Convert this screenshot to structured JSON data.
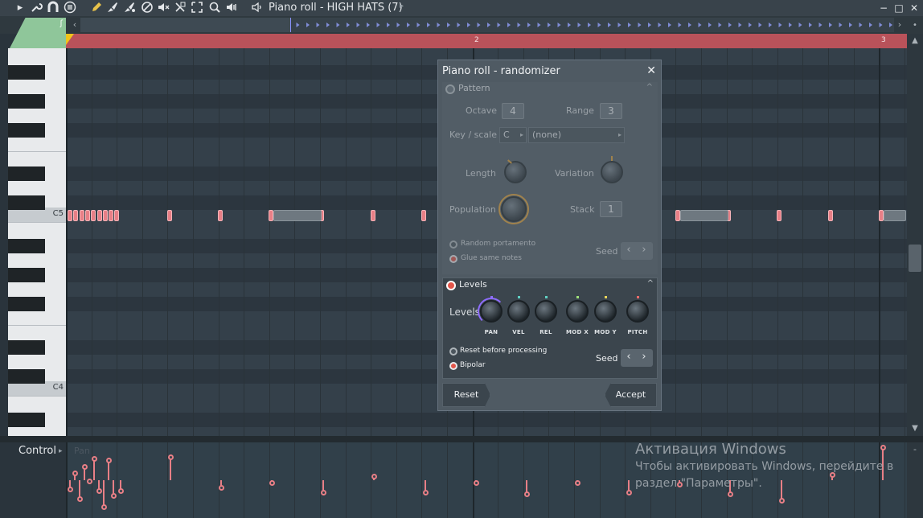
{
  "window": {
    "title": "Piano roll - HIGH HATS (7)",
    "title_arrow": "▸",
    "controls": [
      "−",
      "□",
      "✕"
    ]
  },
  "toolbar": {
    "icons": [
      "menu-arrow-icon",
      "wrench-icon",
      "magnet-icon",
      "options-icon",
      "pencil-icon",
      "paint-brush-icon",
      "brush-icon",
      "delete-icon",
      "mute-icon",
      "slice-icon",
      "select-icon",
      "zoom-icon",
      "playback-icon",
      "speaker-icon"
    ]
  },
  "timeline": {
    "bar_labels": [
      "2",
      "3"
    ]
  },
  "keyboard": {
    "labels": [
      "C5",
      "C4"
    ]
  },
  "control_lane": {
    "label": "Control",
    "arrow": "▸",
    "parameter": "Pan"
  },
  "watermark": {
    "title": "Активация Windows",
    "line1": "Чтобы активировать Windows, перейдите в",
    "line2": "раздел \"Параметры\"."
  },
  "dialog": {
    "title": "Piano roll - randomizer",
    "close": "✕",
    "pattern": {
      "header": "Pattern",
      "collapse": "^",
      "octave_label": "Octave",
      "octave_value": "4",
      "range_label": "Range",
      "range_value": "3",
      "key_scale_label": "Key / scale",
      "key_value": "C",
      "scale_value": "(none)",
      "length_label": "Length",
      "variation_label": "Variation",
      "population_label": "Population",
      "stack_label": "Stack",
      "stack_value": "1",
      "random_portamento": "Random portamento",
      "glue_same_notes": "Glue same notes",
      "seed_label": "Seed"
    },
    "levels": {
      "header": "Levels",
      "collapse": "^",
      "row_label": "Levels",
      "knobs": [
        "PAN",
        "VEL",
        "REL",
        "MOD X",
        "MOD Y",
        "PITCH"
      ],
      "knob_colors": [
        "#8e6cff",
        "#5fd0c4",
        "#5fd0c4",
        "#9ee07a",
        "#e8d45a",
        "#e86a6a"
      ],
      "reset_before_processing": "Reset before processing",
      "bipolar": "Bipolar",
      "seed_label": "Seed"
    },
    "buttons": {
      "reset": "Reset",
      "accept": "Accept"
    }
  },
  "colors": {
    "accent_green": "#8fc69a",
    "timeline_red": "#b9525a",
    "note_pink": "#e87f86",
    "dialog_bg": "#4f5a63"
  }
}
